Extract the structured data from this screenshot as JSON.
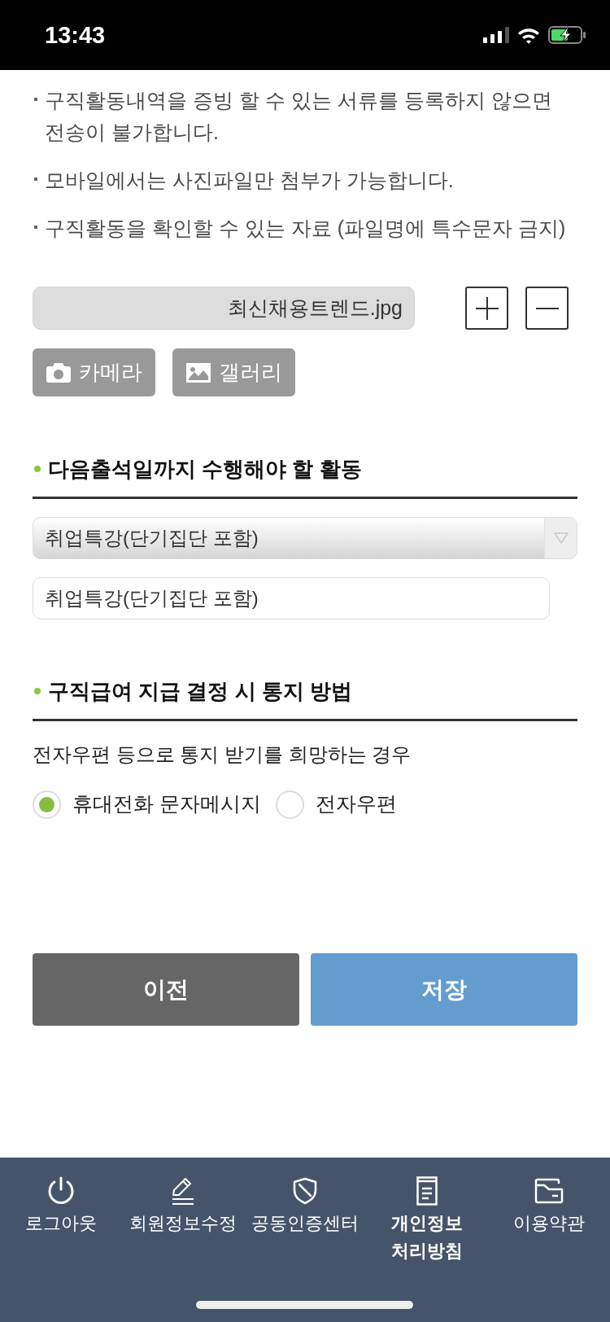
{
  "status_bar": {
    "time": "13:43"
  },
  "notes": [
    "구직활동내역을 증빙 할 수 있는 서류를 등록하지 않으면 전송이 불가합니다.",
    "모바일에서는 사진파일만 첨부가 가능합니다.",
    "구직활동을 확인할 수 있는 자료 (파일명에 특수문자 금지)"
  ],
  "attachment": {
    "file_name": "최신채용트렌드.jpg",
    "buttons": [
      {
        "label": "카메라",
        "kind": "camera"
      },
      {
        "label": "갤러리",
        "kind": "gallery"
      }
    ]
  },
  "activity_section": {
    "title": "다음출석일까지 수행해야 할 활동",
    "select": {
      "value": "취업특강(단기집단 포함)"
    },
    "input": {
      "value": "취업특강(단기집단 포함)"
    }
  },
  "notice_section": {
    "title": "구직급여 지급 결정 시 통지 방법",
    "description": "전자우편 등으로 통지 받기를 희망하는 경우",
    "options": [
      {
        "label": "휴대전화 문자메시지",
        "selected": true
      },
      {
        "label": "전자우편",
        "selected": false
      }
    ]
  },
  "actions": [
    {
      "label": "이전",
      "kind": "secondary"
    },
    {
      "label": "저장",
      "kind": "primary"
    }
  ],
  "bottom_nav": [
    {
      "label": "로그아웃",
      "selected": false
    },
    {
      "label": "회원정보수정",
      "selected": false
    },
    {
      "label": "공동인증센터",
      "selected": false
    },
    {
      "label": "개인정보 처리방침",
      "selected": true
    },
    {
      "label": "이용약관",
      "selected": false
    }
  ]
}
